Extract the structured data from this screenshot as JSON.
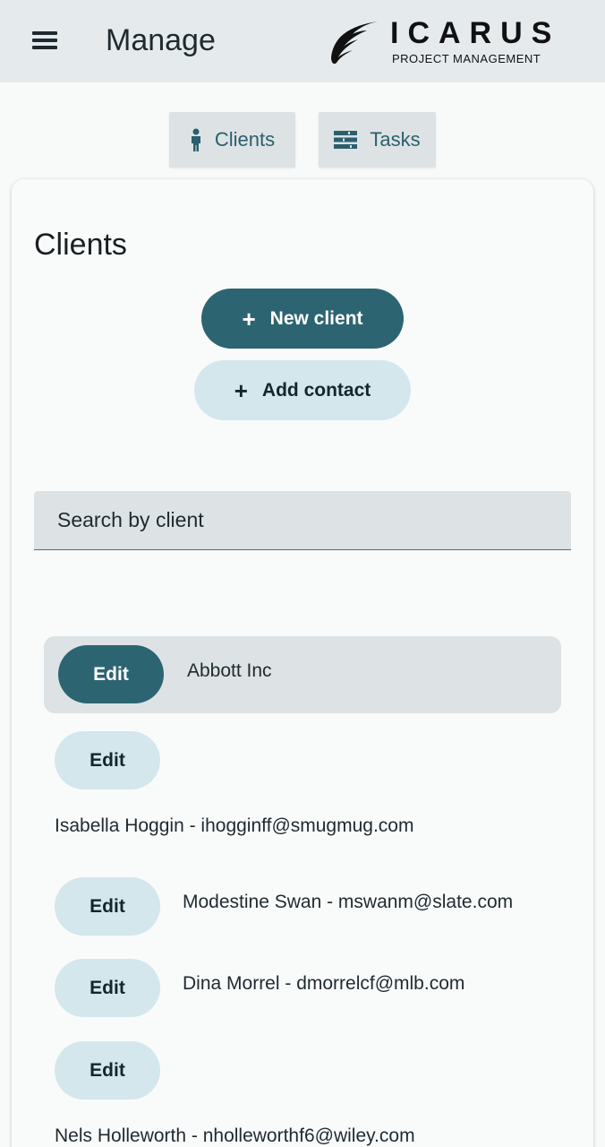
{
  "header": {
    "title": "Manage",
    "logo_word": "ICARUS",
    "logo_subtitle": "PROJECT MANAGEMENT"
  },
  "nav": {
    "clients_label": "Clients",
    "tasks_label": "Tasks"
  },
  "card": {
    "title": "Clients",
    "new_client_label": "New client",
    "add_contact_label": "Add contact",
    "search_placeholder": "Search by client"
  },
  "client": {
    "name": "Abbott Inc",
    "edit_label": "Edit"
  },
  "contacts": [
    {
      "edit_label": "Edit",
      "text": "Isabella Hoggin - ihogginff@smugmug.com"
    },
    {
      "edit_label": "Edit",
      "text": "Modestine Swan - mswanm@slate.com"
    },
    {
      "edit_label": "Edit",
      "text": "Dina Morrel - dmorrelcf@mlb.com"
    },
    {
      "edit_label": "Edit",
      "text": "Nels Holleworth - nholleworthf6@wiley.com"
    }
  ],
  "colors": {
    "primary": "#2d6472",
    "primary_light": "#d3e7ec",
    "header_bg": "#e5ebed",
    "tab_bg": "#dde3e5"
  },
  "icons": {
    "menu": "menu-icon",
    "logo": "wing-logo-icon",
    "clients_tab": "person-icon",
    "tasks_tab": "list-icon",
    "plus": "plus-icon"
  }
}
